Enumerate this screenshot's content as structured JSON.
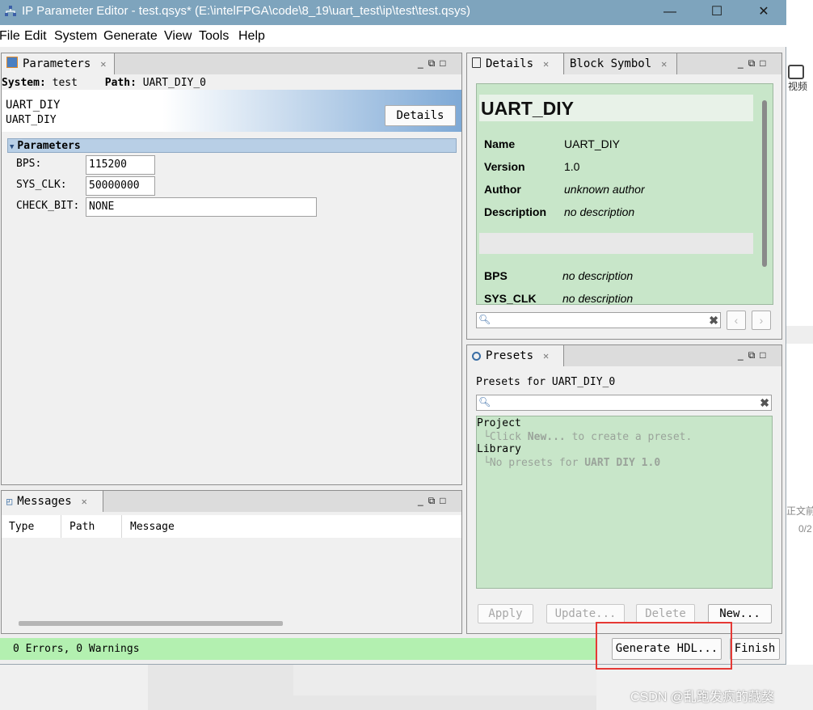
{
  "window": {
    "title": "IP Parameter Editor - test.qsys* (E:\\intelFPGA\\code\\8_19\\uart_test\\ip\\test\\test.qsys)",
    "controls": {
      "minimize": "—",
      "maximize": "☐",
      "close": "✕"
    }
  },
  "menu": [
    "File",
    "Edit",
    "System",
    "Generate",
    "View",
    "Tools",
    "Help"
  ],
  "parameters_pane": {
    "tab": "Parameters",
    "system_label": "System:",
    "system_value": "test",
    "path_label": "Path:",
    "path_value": "UART_DIY_0",
    "component_name": "UART_DIY",
    "component_sub": "UART_DIY",
    "details_button": "Details",
    "section": "Parameters",
    "fields": [
      {
        "label": "BPS:",
        "value": "115200"
      },
      {
        "label": "SYS_CLK:",
        "value": "50000000"
      },
      {
        "label": "CHECK_BIT:",
        "value": "NONE"
      }
    ]
  },
  "details_pane": {
    "tabs": [
      "Details",
      "Block Symbol"
    ],
    "heading": "UART_DIY",
    "rows": [
      {
        "name": "Name",
        "value": "UART_DIY"
      },
      {
        "name": "Version",
        "value": "1.0"
      },
      {
        "name": "Author",
        "value": "unknown author"
      },
      {
        "name": "Description",
        "value": "no description"
      }
    ],
    "param_rows": [
      {
        "name": "BPS",
        "value": "no description"
      },
      {
        "name": "SYS_CLK",
        "value": "no description"
      }
    ]
  },
  "presets_pane": {
    "tab": "Presets",
    "header": "Presets for UART_DIY_0",
    "tree": {
      "project": "Project",
      "project_hint_pre": "Click",
      "project_hint_bold": "New...",
      "project_hint_post": "to create a preset.",
      "library": "Library",
      "library_hint_pre": "No presets for",
      "library_hint_bold": "UART DIY 1.0"
    },
    "buttons": {
      "apply": "Apply",
      "update": "Update...",
      "delete": "Delete",
      "new": "New..."
    }
  },
  "messages_pane": {
    "tab": "Messages",
    "columns": [
      "Type",
      "Path",
      "Message"
    ]
  },
  "statusbar": {
    "status": "0 Errors, 0 Warnings",
    "generate": "Generate HDL...",
    "finish": "Finish"
  },
  "background": {
    "side_text_1": "视频",
    "side_text_2": "正文前",
    "side_text_3": "0/2",
    "watermark": "CSDN @乱跑发疯的藏獒"
  },
  "colors": {
    "titlebar": "#7ea4bd",
    "status_green": "#b3f0b0",
    "details_green": "#c8e6c9",
    "highlight_red": "#e53935"
  }
}
